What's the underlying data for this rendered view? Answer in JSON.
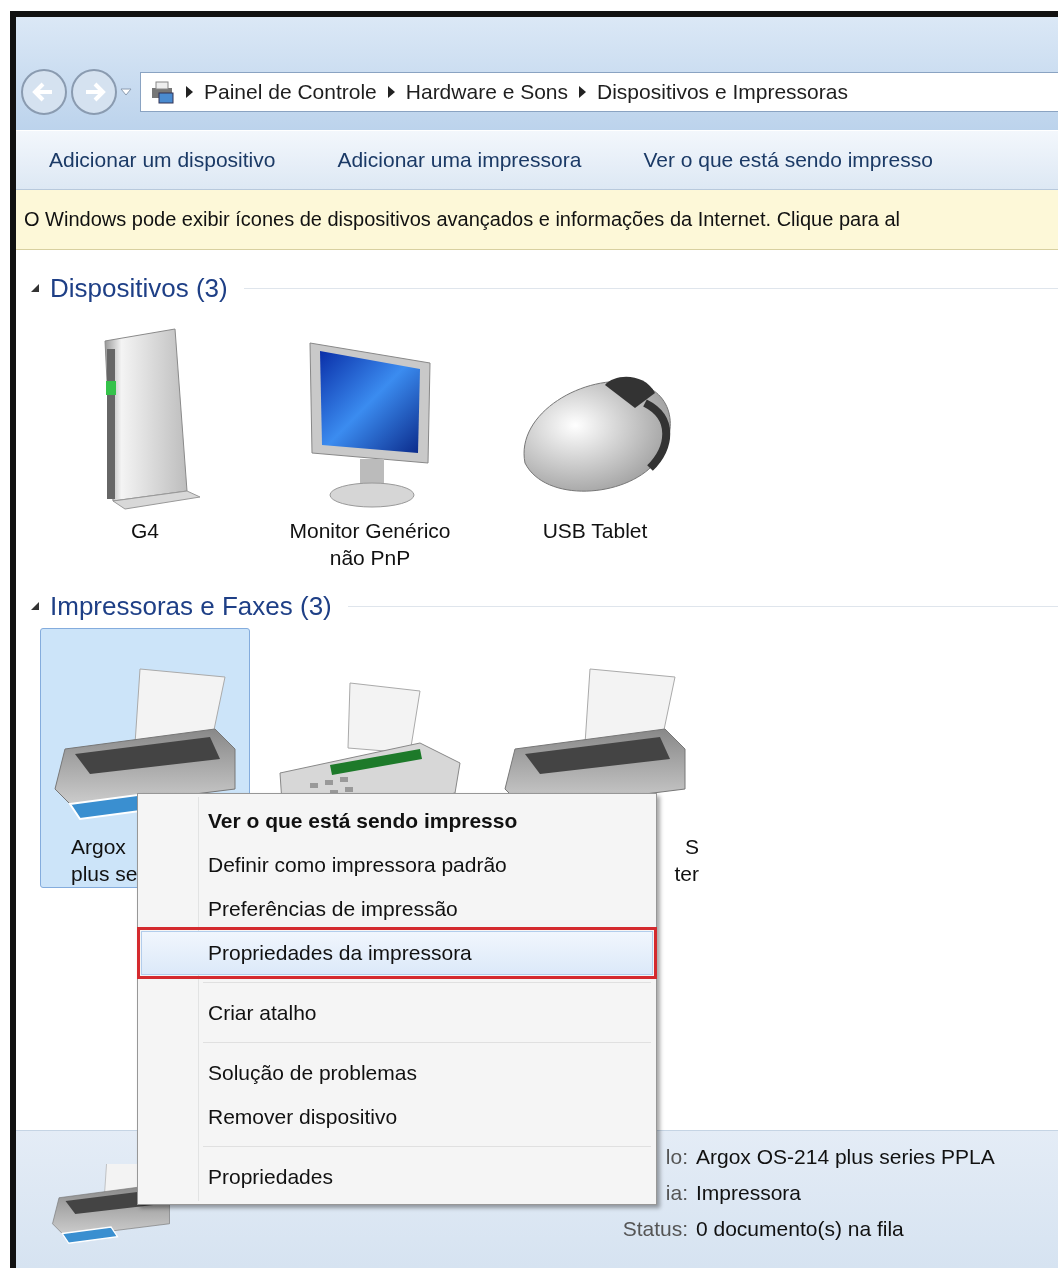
{
  "window": {
    "breadcrumb": [
      "Painel de Controle",
      "Hardware e Sons",
      "Dispositivos e Impressoras"
    ]
  },
  "toolbar": [
    "Adicionar um dispositivo",
    "Adicionar uma impressora",
    "Ver o que está sendo impresso"
  ],
  "info_bar": "O Windows pode exibir ícones de dispositivos avançados e informações da Internet. Clique para al",
  "sections": [
    {
      "title": "Dispositivos (3)",
      "expanded": true,
      "items": [
        {
          "kind": "drive",
          "label_lines": [
            "G4"
          ],
          "selected": false
        },
        {
          "kind": "monitor",
          "label_lines": [
            "Monitor Genérico",
            "não PnP"
          ],
          "selected": false
        },
        {
          "kind": "mouse",
          "label_lines": [
            "USB Tablet"
          ],
          "selected": false
        }
      ]
    },
    {
      "title": "Impressoras e Faxes (3)",
      "expanded": true,
      "items": [
        {
          "kind": "printer",
          "label_lines": [
            "Argox",
            "plus se"
          ],
          "selected": true
        },
        {
          "kind": "fax",
          "selected": false
        },
        {
          "kind": "printer",
          "label_lines": [
            "S",
            "ter"
          ],
          "selected": false
        }
      ]
    }
  ],
  "context_menu": {
    "groups": [
      [
        {
          "label": "Ver o que está sendo impresso",
          "kind": "default",
          "selected": false
        },
        {
          "label": "Definir como impressora padrão",
          "kind": "normal",
          "selected": false
        },
        {
          "label": "Preferências de impressão",
          "kind": "normal",
          "selected": false
        },
        {
          "label": "Propriedades da impressora",
          "kind": "normal",
          "selected": true
        }
      ],
      [
        {
          "label": "Criar atalho",
          "kind": "normal",
          "selected": false
        }
      ],
      [
        {
          "label": "Solução de problemas",
          "kind": "normal",
          "selected": false
        },
        {
          "label": "Remover dispositivo",
          "kind": "normal",
          "selected": false
        }
      ],
      [
        {
          "label": "Propriedades",
          "kind": "normal",
          "selected": false
        }
      ]
    ]
  },
  "details": {
    "fields": [
      {
        "label": "lo:",
        "value": "Argox OS-214 plus series PPLA"
      },
      {
        "label": "ia:",
        "value": "Impressora"
      },
      {
        "label": "Status:",
        "value": "0 documento(s) na fila"
      }
    ]
  }
}
